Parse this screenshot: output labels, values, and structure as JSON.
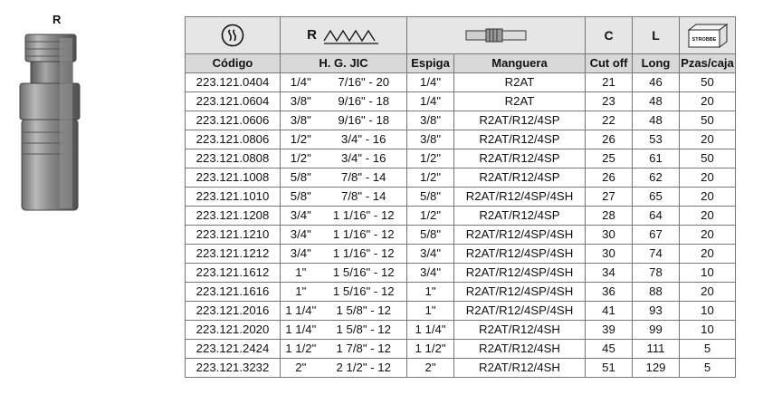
{
  "fitting": {
    "label": "R",
    "icon": "hose-fitting-illustration"
  },
  "header_icons": {
    "brand_icon": "stroke-logo-circle-icon",
    "thread_letter": "R",
    "thread_icon": "thread-zigzag-icon",
    "hose_icon": "hose-icon",
    "cutoff_letter": "C",
    "length_letter": "L",
    "box_icon": "box-icon",
    "box_brand": "STROBBE"
  },
  "columns": {
    "codigo": "Código",
    "hgjic": "H. G. JIC",
    "espiga": "Espiga",
    "manguera": "Manguera",
    "cutoff": "Cut off",
    "long": "Long",
    "pzas": "Pzas/caja"
  },
  "rows": [
    {
      "codigo": "223.121.0404",
      "size": "1/4\"",
      "jic": "7/16\" - 20",
      "espiga": "1/4\"",
      "manguera": "R2AT",
      "cutoff": "21",
      "long": "46",
      "pzas": "50"
    },
    {
      "codigo": "223.121.0604",
      "size": "3/8\"",
      "jic": "9/16\" - 18",
      "espiga": "1/4\"",
      "manguera": "R2AT",
      "cutoff": "23",
      "long": "48",
      "pzas": "20"
    },
    {
      "codigo": "223.121.0606",
      "size": "3/8\"",
      "jic": "9/16\" - 18",
      "espiga": "3/8\"",
      "manguera": "R2AT/R12/4SP",
      "cutoff": "22",
      "long": "48",
      "pzas": "50"
    },
    {
      "codigo": "223.121.0806",
      "size": "1/2\"",
      "jic": "3/4\" - 16",
      "espiga": "3/8\"",
      "manguera": "R2AT/R12/4SP",
      "cutoff": "26",
      "long": "53",
      "pzas": "20"
    },
    {
      "codigo": "223.121.0808",
      "size": "1/2\"",
      "jic": "3/4\" - 16",
      "espiga": "1/2\"",
      "manguera": "R2AT/R12/4SP",
      "cutoff": "25",
      "long": "61",
      "pzas": "50"
    },
    {
      "codigo": "223.121.1008",
      "size": "5/8\"",
      "jic": "7/8\" - 14",
      "espiga": "1/2\"",
      "manguera": "R2AT/R12/4SP",
      "cutoff": "26",
      "long": "62",
      "pzas": "20"
    },
    {
      "codigo": "223.121.1010",
      "size": "5/8\"",
      "jic": "7/8\" - 14",
      "espiga": "5/8\"",
      "manguera": "R2AT/R12/4SP/4SH",
      "cutoff": "27",
      "long": "65",
      "pzas": "20"
    },
    {
      "codigo": "223.121.1208",
      "size": "3/4\"",
      "jic": "1 1/16\" - 12",
      "espiga": "1/2\"",
      "manguera": "R2AT/R12/4SP",
      "cutoff": "28",
      "long": "64",
      "pzas": "20"
    },
    {
      "codigo": "223.121.1210",
      "size": "3/4\"",
      "jic": "1 1/16\" - 12",
      "espiga": "5/8\"",
      "manguera": "R2AT/R12/4SP/4SH",
      "cutoff": "30",
      "long": "67",
      "pzas": "20"
    },
    {
      "codigo": "223.121.1212",
      "size": "3/4\"",
      "jic": "1 1/16\" - 12",
      "espiga": "3/4\"",
      "manguera": "R2AT/R12/4SP/4SH",
      "cutoff": "30",
      "long": "74",
      "pzas": "20"
    },
    {
      "codigo": "223.121.1612",
      "size": "1\"",
      "jic": "1 5/16\" - 12",
      "espiga": "3/4\"",
      "manguera": "R2AT/R12/4SP/4SH",
      "cutoff": "34",
      "long": "78",
      "pzas": "10"
    },
    {
      "codigo": "223.121.1616",
      "size": "1\"",
      "jic": "1 5/16\" - 12",
      "espiga": "1\"",
      "manguera": "R2AT/R12/4SP/4SH",
      "cutoff": "36",
      "long": "88",
      "pzas": "20"
    },
    {
      "codigo": "223.121.2016",
      "size": "1 1/4\"",
      "jic": "1 5/8\" - 12",
      "espiga": "1\"",
      "manguera": "R2AT/R12/4SP/4SH",
      "cutoff": "41",
      "long": "93",
      "pzas": "10"
    },
    {
      "codigo": "223.121.2020",
      "size": "1 1/4\"",
      "jic": "1 5/8\" - 12",
      "espiga": "1 1/4\"",
      "manguera": "R2AT/R12/4SH",
      "cutoff": "39",
      "long": "99",
      "pzas": "10"
    },
    {
      "codigo": "223.121.2424",
      "size": "1 1/2\"",
      "jic": "1 7/8\" - 12",
      "espiga": "1 1/2\"",
      "manguera": "R2AT/R12/4SH",
      "cutoff": "45",
      "long": "111",
      "pzas": "5"
    },
    {
      "codigo": "223.121.3232",
      "size": "2\"",
      "jic": "2 1/2\" - 12",
      "espiga": "2\"",
      "manguera": "R2AT/R12/4SH",
      "cutoff": "51",
      "long": "129",
      "pzas": "5"
    }
  ]
}
